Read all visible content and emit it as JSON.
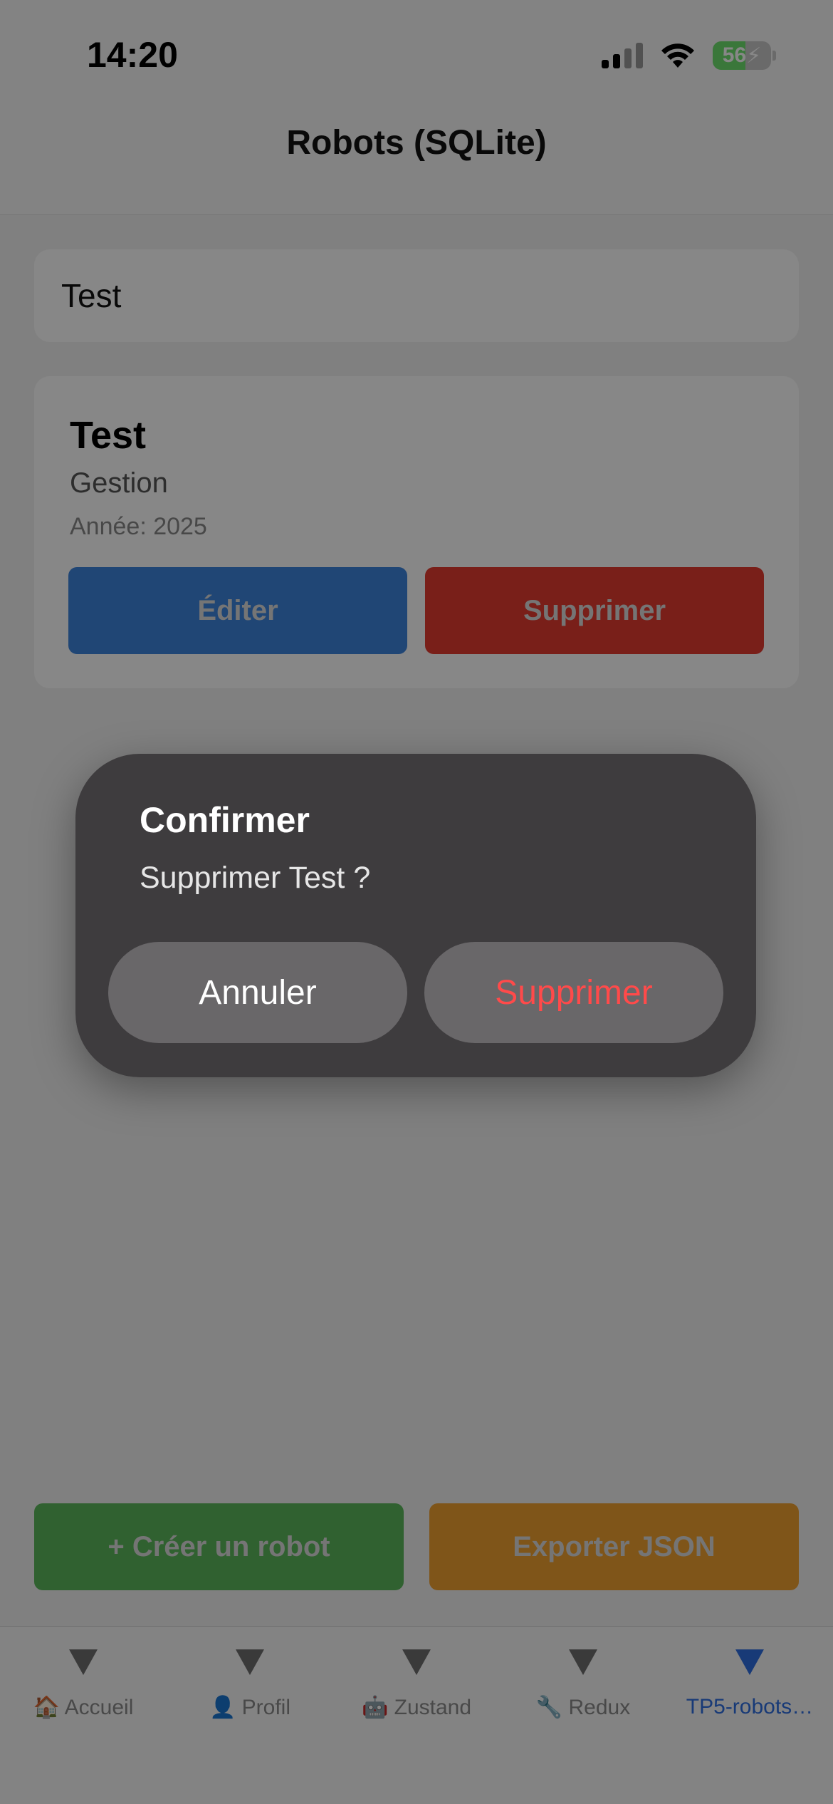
{
  "status_bar": {
    "time": "14:20",
    "battery_level": "56"
  },
  "header": {
    "title": "Robots (SQLite)"
  },
  "search": {
    "value": "Test"
  },
  "robot_card": {
    "name": "Test",
    "type": "Gestion",
    "year": "Année: 2025",
    "edit_label": "Éditer",
    "delete_label": "Supprimer"
  },
  "actions": {
    "create_label": "+ Créer un robot",
    "export_label": "Exporter JSON"
  },
  "tabs": [
    {
      "label": "🏠 Accueil"
    },
    {
      "label": "👤 Profil"
    },
    {
      "label": "🤖 Zustand"
    },
    {
      "label": "🔧 Redux"
    },
    {
      "label": "TP5-robots…"
    }
  ],
  "dialog": {
    "title": "Confirmer",
    "message": "Supprimer Test ?",
    "cancel_label": "Annuler",
    "confirm_label": "Supprimer"
  },
  "colors": {
    "edit": "#3e84dd",
    "delete": "#e43b30",
    "create": "#5cb85c",
    "export": "#f0a030",
    "active_tab": "#2f6fe0",
    "destructive_text": "#ff4a4a"
  }
}
